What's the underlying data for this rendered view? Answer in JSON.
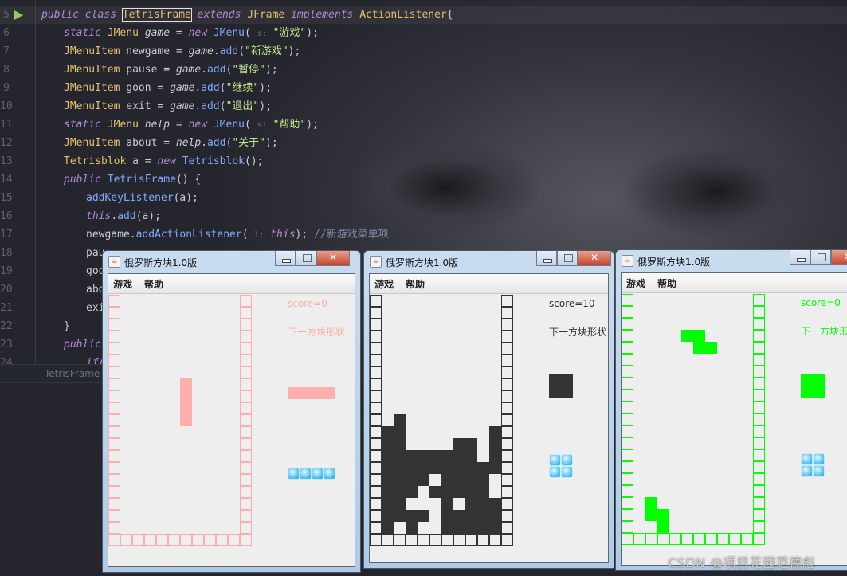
{
  "editor": {
    "lines": [
      {
        "n": "5",
        "indent": 0,
        "hl": true,
        "run": true,
        "tokens": [
          [
            "public class ",
            "kw"
          ],
          [
            "TetrisFrame",
            "ty boxed"
          ],
          [
            " extends ",
            "kw"
          ],
          [
            "JFrame",
            "ty"
          ],
          [
            " implements ",
            "kw"
          ],
          [
            "ActionListener",
            "ty"
          ],
          [
            "{",
            ""
          ]
        ]
      },
      {
        "n": "6",
        "indent": 1,
        "tokens": [
          [
            "static ",
            "kw"
          ],
          [
            "JMenu ",
            "ty"
          ],
          [
            "game",
            "it"
          ],
          [
            " = ",
            ""
          ],
          [
            "new ",
            "kw"
          ],
          [
            "JMenu",
            "fn"
          ],
          [
            "( ",
            ""
          ],
          [
            "s:",
            "hint"
          ],
          [
            " \"游戏\"",
            "st"
          ],
          [
            ");",
            ""
          ]
        ]
      },
      {
        "n": "7",
        "indent": 1,
        "tokens": [
          [
            "JMenuItem ",
            "ty"
          ],
          [
            "newgame",
            ""
          ],
          [
            " = ",
            ""
          ],
          [
            "game",
            "it"
          ],
          [
            ".",
            ""
          ],
          [
            "add",
            "fn"
          ],
          [
            "(",
            ""
          ],
          [
            "\"新游戏\"",
            "st"
          ],
          [
            ");",
            ""
          ]
        ]
      },
      {
        "n": "8",
        "indent": 1,
        "tokens": [
          [
            "JMenuItem ",
            "ty"
          ],
          [
            "pause",
            ""
          ],
          [
            " = ",
            ""
          ],
          [
            "game",
            "it"
          ],
          [
            ".",
            ""
          ],
          [
            "add",
            "fn"
          ],
          [
            "(",
            ""
          ],
          [
            "\"暂停\"",
            "st"
          ],
          [
            ");",
            ""
          ]
        ]
      },
      {
        "n": "9",
        "indent": 1,
        "tokens": [
          [
            "JMenuItem ",
            "ty"
          ],
          [
            "goon",
            ""
          ],
          [
            " = ",
            ""
          ],
          [
            "game",
            "it"
          ],
          [
            ".",
            ""
          ],
          [
            "add",
            "fn"
          ],
          [
            "(",
            ""
          ],
          [
            "\"继续\"",
            "st"
          ],
          [
            ");",
            ""
          ]
        ]
      },
      {
        "n": "10",
        "indent": 1,
        "tokens": [
          [
            "JMenuItem ",
            "ty"
          ],
          [
            "exit",
            ""
          ],
          [
            " = ",
            ""
          ],
          [
            "game",
            "it"
          ],
          [
            ".",
            ""
          ],
          [
            "add",
            "fn"
          ],
          [
            "(",
            ""
          ],
          [
            "\"退出\"",
            "st"
          ],
          [
            ");",
            ""
          ]
        ]
      },
      {
        "n": "11",
        "indent": 1,
        "tokens": [
          [
            "static ",
            "kw"
          ],
          [
            "JMenu ",
            "ty"
          ],
          [
            "help",
            "it"
          ],
          [
            " = ",
            ""
          ],
          [
            "new ",
            "kw"
          ],
          [
            "JMenu",
            "fn"
          ],
          [
            "( ",
            ""
          ],
          [
            "s:",
            "hint"
          ],
          [
            " \"帮助\"",
            "st"
          ],
          [
            ");",
            ""
          ]
        ]
      },
      {
        "n": "12",
        "indent": 1,
        "tokens": [
          [
            "JMenuItem ",
            "ty"
          ],
          [
            "about",
            ""
          ],
          [
            " = ",
            ""
          ],
          [
            "help",
            "it"
          ],
          [
            ".",
            ""
          ],
          [
            "add",
            "fn"
          ],
          [
            "(",
            ""
          ],
          [
            "\"关于\"",
            "st"
          ],
          [
            ");",
            ""
          ]
        ]
      },
      {
        "n": "13",
        "indent": 1,
        "tokens": [
          [
            "Tetrisblok ",
            "ty"
          ],
          [
            "a",
            ""
          ],
          [
            " = ",
            ""
          ],
          [
            "new ",
            "kw"
          ],
          [
            "Tetrisblok",
            "fn"
          ],
          [
            "();",
            ""
          ]
        ]
      },
      {
        "n": "14",
        "indent": 1,
        "tokens": [
          [
            "public ",
            "kw"
          ],
          [
            "TetrisFrame",
            "fn"
          ],
          [
            "() {",
            ""
          ]
        ]
      },
      {
        "n": "15",
        "indent": 2,
        "tokens": [
          [
            "addKeyListener",
            "fn"
          ],
          [
            "(a);",
            ""
          ]
        ]
      },
      {
        "n": "16",
        "indent": 2,
        "tokens": [
          [
            "this",
            "kw"
          ],
          [
            ".",
            ""
          ],
          [
            "add",
            "fn"
          ],
          [
            "(a);",
            ""
          ]
        ]
      },
      {
        "n": "17",
        "indent": 2,
        "tokens": [
          [
            "newgame.",
            ""
          ],
          [
            "addActionListener",
            "fn"
          ],
          [
            "( ",
            ""
          ],
          [
            "l:",
            "hint"
          ],
          [
            " this",
            "kw"
          ],
          [
            "); ",
            ""
          ],
          [
            "//新游戏菜单项",
            "cm"
          ]
        ]
      },
      {
        "n": "18",
        "indent": 2,
        "tokens": [
          [
            "pau",
            ""
          ]
        ]
      },
      {
        "n": "19",
        "indent": 2,
        "tokens": [
          [
            "goo",
            ""
          ]
        ]
      },
      {
        "n": "20",
        "indent": 2,
        "tokens": [
          [
            "abo",
            ""
          ]
        ]
      },
      {
        "n": "21",
        "indent": 2,
        "tokens": [
          [
            "exi",
            ""
          ]
        ]
      },
      {
        "n": "22",
        "indent": 1,
        "tokens": [
          [
            "}",
            ""
          ]
        ]
      },
      {
        "n": "23",
        "indent": 1,
        "tokens": [
          [
            "public",
            "kw"
          ]
        ]
      },
      {
        "n": "24",
        "indent": 2,
        "tokens": [
          [
            "if(",
            "kw"
          ]
        ]
      }
    ],
    "tab": "TetrisFrame"
  },
  "windows": [
    {
      "title": "俄罗斯方块1.0版",
      "menu": [
        "游戏",
        "帮助"
      ],
      "color": "#ffaeae",
      "score": "score=0",
      "next_label": "下一方块形状",
      "next_shape": "I-horizontal",
      "icon_layout": "1x4",
      "board": [
        "..........",
        "..........",
        "..........",
        "..........",
        "..........",
        "..........",
        "..........",
        ".....#....",
        ".....#....",
        ".....#....",
        ".....#....",
        "..........",
        "..........",
        "..........",
        "..........",
        "..........",
        "..........",
        "..........",
        "..........",
        ".........."
      ]
    },
    {
      "title": "俄罗斯方块1.0版",
      "menu": [
        "游戏",
        "帮助"
      ],
      "color": "#333333",
      "score": "score=10",
      "next_label": "下一方块形状",
      "next_shape": "O",
      "icon_layout": "2x2",
      "board": [
        "..........",
        "..........",
        "..........",
        "..........",
        "..........",
        "..........",
        "..........",
        "..........",
        "..........",
        "..........",
        ".#........",
        "##.......#",
        "##....##.#",
        "########.#",
        "##########",
        "####.####.",
        "###.#####.",
        "##...#.###",
        "####.#####",
        "#.#..#####"
      ]
    },
    {
      "title": "俄罗斯方块1.0版",
      "menu": [
        "游戏",
        "帮助"
      ],
      "color": "#00ff00",
      "score": "score=0",
      "next_label": "下一方块形状",
      "next_shape": "O",
      "icon_layout": "2x2",
      "board": [
        "..........",
        "..........",
        "..........",
        "....##....",
        ".....##...",
        "..........",
        "..........",
        "..........",
        "..........",
        "..........",
        "..........",
        "..........",
        "..........",
        "..........",
        "..........",
        "..........",
        "..........",
        ".#........",
        ".##.......",
        "..#......."
      ]
    }
  ],
  "watermark": "CSDN @项目花园范德彪"
}
